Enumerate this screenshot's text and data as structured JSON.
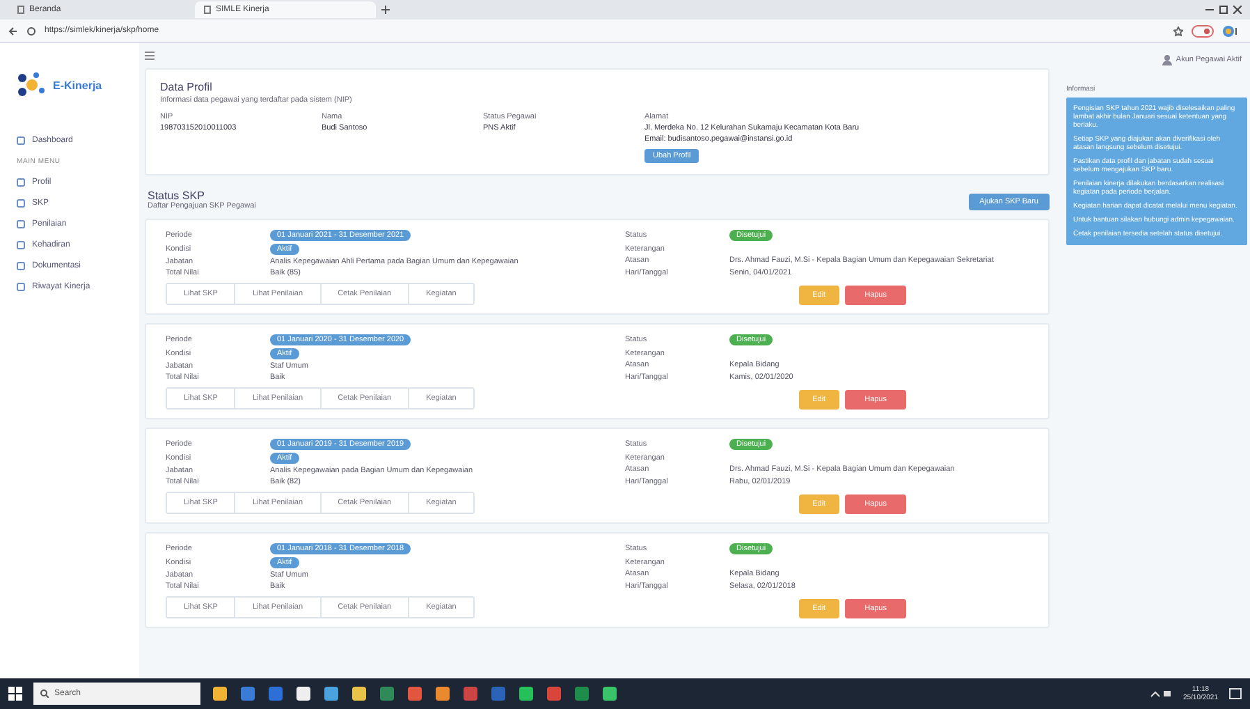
{
  "browser": {
    "tabs": [
      {
        "title": "Beranda",
        "selected": false
      },
      {
        "title": "SIMLE Kinerja",
        "selected": true
      }
    ],
    "address": "https://simlek/kinerja/skp/home"
  },
  "sidebar": {
    "logo": "E-Kinerja",
    "items": [
      {
        "label": "Dashboard",
        "kind": "item"
      },
      {
        "label": "MAIN MENU",
        "kind": "section"
      },
      {
        "label": "Profil",
        "kind": "item"
      },
      {
        "label": "SKP",
        "kind": "item"
      },
      {
        "label": "Penilaian",
        "kind": "item"
      },
      {
        "label": "Kehadiran",
        "kind": "item"
      },
      {
        "label": "Dokumentasi",
        "kind": "item"
      },
      {
        "label": "Riwayat Kinerja",
        "kind": "item"
      }
    ]
  },
  "user": "Akun Pegawai Aktif",
  "profile": {
    "title": "Data Profil",
    "subtitle": "Informasi data pegawai yang terdaftar pada sistem (NIP)",
    "fields": [
      {
        "label": "NIP",
        "value": "198703152010011003"
      },
      {
        "label": "Nama",
        "value": "Budi Santoso"
      },
      {
        "label": "Status Pegawai",
        "value": "PNS Aktif"
      }
    ],
    "address_label": "Alamat",
    "address": "Jl. Merdeka No. 12 Kelurahan Sukamaju Kecamatan Kota Baru",
    "email": "Email: budisantoso.pegawai@instansi.go.id",
    "button": "Ubah Profil"
  },
  "skp": {
    "title": "Status SKP",
    "subtitle": "Daftar Pengajuan SKP Pegawai",
    "button": "Ajukan SKP Baru",
    "entries": [
      {
        "left": [
          {
            "label": "Periode",
            "value": "01 Januari 2021 - 31 Desember 2021",
            "kind": "badge",
            "color": "#5b9bd5"
          },
          {
            "label": "Kondisi",
            "value": "Aktif",
            "kind": "badge",
            "color": "#5b9bd5"
          },
          {
            "label": "Jabatan",
            "value": "Analis Kepegawaian Ahli Pertama pada Bagian Umum dan Kepegawaian",
            "kind": "text"
          },
          {
            "label": "Total Nilai",
            "value": "Baik (85)",
            "kind": "text"
          }
        ],
        "right": [
          {
            "label": "Status",
            "value": "Disetujui",
            "kind": "badge",
            "color": "#4caf50"
          },
          {
            "label": "Keterangan",
            "kind": "text"
          },
          {
            "label": "Atasan",
            "value": "Drs. Ahmad Fauzi, M.Si - Kepala Bagian Umum dan Kepegawaian Sekretariat",
            "kind": "text"
          },
          {
            "label": "Hari/Tanggal",
            "value": "Senin, 04/01/2021",
            "kind": "text"
          }
        ],
        "actions": [
          "Lihat SKP",
          "Lihat Penilaian",
          "Cetak Penilaian",
          "Kegiatan"
        ],
        "edit": "Edit",
        "delete": "Hapus"
      },
      {
        "left": [
          {
            "label": "Periode",
            "value": "01 Januari 2020 - 31 Desember 2020",
            "kind": "badge",
            "color": "#5b9bd5"
          },
          {
            "label": "Kondisi",
            "value": "Aktif",
            "kind": "badge",
            "color": "#5b9bd5"
          },
          {
            "label": "Jabatan",
            "value": "Staf Umum",
            "kind": "text"
          },
          {
            "label": "Total Nilai",
            "value": "Baik",
            "kind": "text"
          }
        ],
        "right": [
          {
            "label": "Status",
            "value": "Disetujui",
            "kind": "badge",
            "color": "#4caf50"
          },
          {
            "label": "Keterangan",
            "kind": "text"
          },
          {
            "label": "Atasan",
            "value": "Kepala Bidang",
            "kind": "text"
          },
          {
            "label": "Hari/Tanggal",
            "value": "Kamis, 02/01/2020",
            "kind": "text"
          }
        ],
        "actions": [
          "Lihat SKP",
          "Lihat Penilaian",
          "Cetak Penilaian",
          "Kegiatan"
        ],
        "edit": "Edit",
        "delete": "Hapus"
      },
      {
        "left": [
          {
            "label": "Periode",
            "value": "01 Januari 2019 - 31 Desember 2019",
            "kind": "badge",
            "color": "#5b9bd5"
          },
          {
            "label": "Kondisi",
            "value": "Aktif",
            "kind": "badge",
            "color": "#5b9bd5"
          },
          {
            "label": "Jabatan",
            "value": "Analis Kepegawaian pada Bagian Umum dan Kepegawaian",
            "kind": "text"
          },
          {
            "label": "Total Nilai",
            "value": "Baik (82)",
            "kind": "text"
          }
        ],
        "right": [
          {
            "label": "Status",
            "value": "Disetujui",
            "kind": "badge",
            "color": "#4caf50"
          },
          {
            "label": "Keterangan",
            "kind": "text"
          },
          {
            "label": "Atasan",
            "value": "Drs. Ahmad Fauzi, M.Si - Kepala Bagian Umum dan Kepegawaian",
            "kind": "text"
          },
          {
            "label": "Hari/Tanggal",
            "value": "Rabu, 02/01/2019",
            "kind": "text"
          }
        ],
        "actions": [
          "Lihat SKP",
          "Lihat Penilaian",
          "Cetak Penilaian",
          "Kegiatan"
        ],
        "edit": "Edit",
        "delete": "Hapus"
      },
      {
        "left": [
          {
            "label": "Periode",
            "value": "01 Januari 2018 - 31 Desember 2018",
            "kind": "badge",
            "color": "#5b9bd5"
          },
          {
            "label": "Kondisi",
            "value": "Aktif",
            "kind": "badge",
            "color": "#5b9bd5"
          },
          {
            "label": "Jabatan",
            "value": "Staf Umum",
            "kind": "text"
          },
          {
            "label": "Total Nilai",
            "value": "Baik",
            "kind": "text"
          }
        ],
        "right": [
          {
            "label": "Status",
            "value": "Disetujui",
            "kind": "badge",
            "color": "#4caf50"
          },
          {
            "label": "Keterangan",
            "kind": "text"
          },
          {
            "label": "Atasan",
            "value": "Kepala Bidang",
            "kind": "text"
          },
          {
            "label": "Hari/Tanggal",
            "value": "Selasa, 02/01/2018",
            "kind": "text"
          }
        ],
        "actions": [
          "Lihat SKP",
          "Lihat Penilaian",
          "Cetak Penilaian",
          "Kegiatan"
        ],
        "edit": "Edit",
        "delete": "Hapus"
      }
    ]
  },
  "alert": {
    "title": "Informasi",
    "paragraphs": [
      "Pengisian SKP tahun 2021 wajib diselesaikan paling lambat akhir bulan Januari sesuai ketentuan yang berlaku.",
      "Setiap SKP yang diajukan akan diverifikasi oleh atasan langsung sebelum disetujui.",
      "Pastikan data profil dan jabatan sudah sesuai sebelum mengajukan SKP baru.",
      "Penilaian kinerja dilakukan berdasarkan realisasi kegiatan pada periode berjalan.",
      "Kegiatan harian dapat dicatat melalui menu kegiatan.",
      "Untuk bantuan silakan hubungi admin kepegawaian.",
      "Cetak penilaian tersedia setelah status disetujui."
    ]
  },
  "taskbar": {
    "search": "Search",
    "time": "11:18",
    "date": "25/10/2021"
  }
}
